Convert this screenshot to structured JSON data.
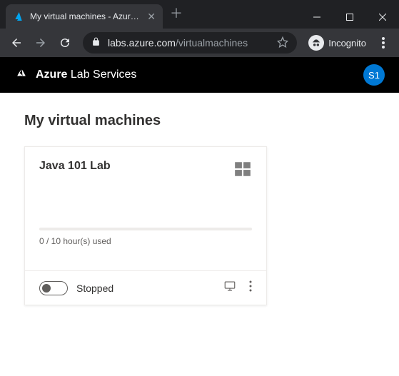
{
  "browser": {
    "tab_title": "My virtual machines - Azure Lab",
    "url_domain": "labs.azure.com",
    "url_path": "/virtualmachines",
    "incognito_label": "Incognito"
  },
  "app": {
    "brand_bold": "Azure",
    "brand_rest": "Lab Services",
    "user_initials": "S1"
  },
  "page": {
    "title": "My virtual machines"
  },
  "vm_card": {
    "lab_name": "Java 101 Lab",
    "os_icon": "windows-icon",
    "quota_text": "0 / 10 hour(s) used",
    "status_label": "Stopped"
  }
}
